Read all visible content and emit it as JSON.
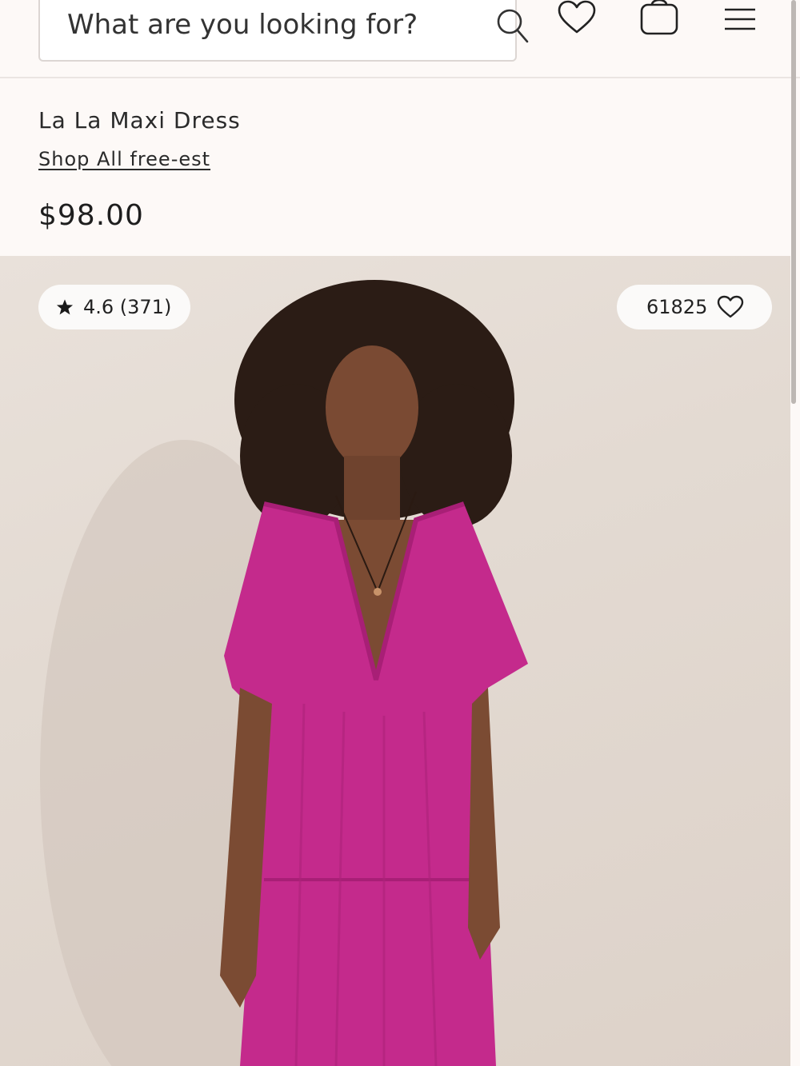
{
  "header": {
    "search_placeholder": "What are you looking for?",
    "icons": [
      "search-icon",
      "heart-icon",
      "shopping-bag-icon",
      "hamburger-menu-icon"
    ]
  },
  "product": {
    "name": "La La Maxi Dress",
    "brand_link": "Shop All free-est",
    "price": "$98.00",
    "rating": "4.6 (371)",
    "likes": "61825",
    "dress_color": "#c42a8c"
  },
  "colors": {
    "background": "#fdf9f7",
    "text": "#222222",
    "accent_dress": "#c42a8c"
  }
}
